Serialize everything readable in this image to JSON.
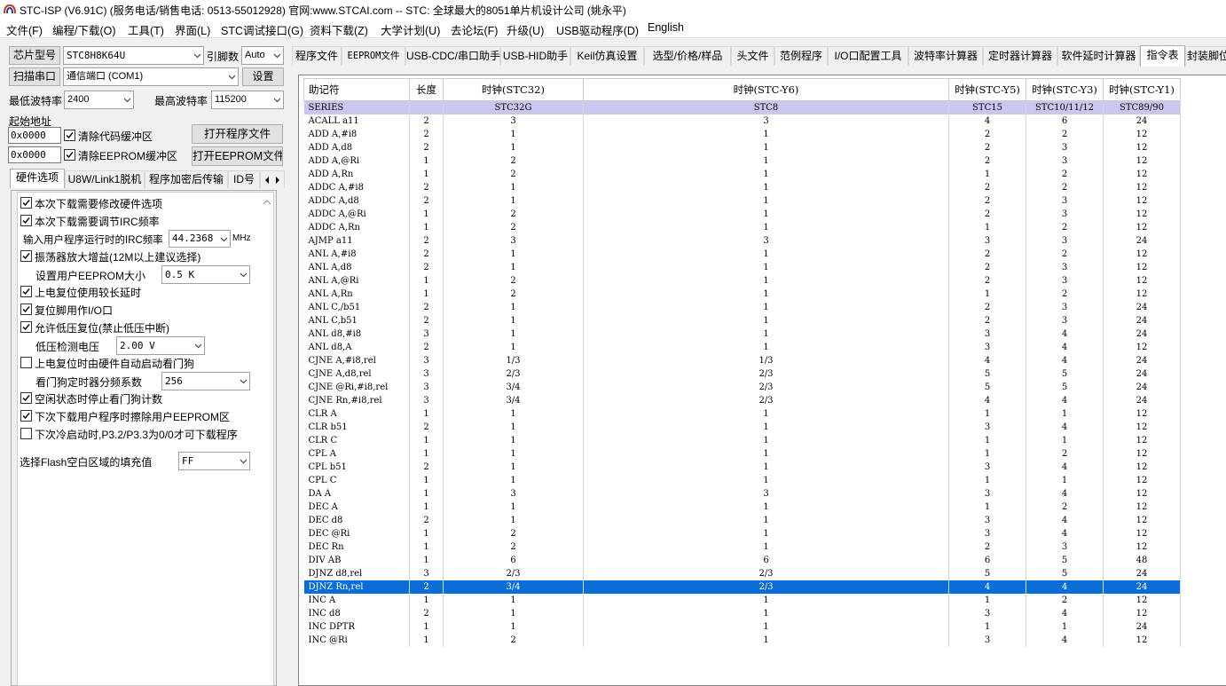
{
  "window": {
    "title": "STC-ISP (V6.91C) (服务电话/销售电话: 0513-55012928) 官网:www.STCAI.com  -- STC: 全球最大的8051单片机设计公司 (姚永平)"
  },
  "menu": [
    "文件(F)",
    "编程/下载(O)",
    "工具(T)",
    "界面(L)",
    "STC调试接口(G)",
    "资料下载(Z)",
    "大学计划(U)",
    "去论坛(F)",
    "升级(U)",
    "USB驱动程序(D)",
    "English"
  ],
  "left": {
    "chip_btn": "芯片型号",
    "chip_value": "STC8H8K64U",
    "pin_label": "引脚数",
    "pin_value": "Auto",
    "scan_btn": "扫描串口",
    "port_value": "通信端口 (COM1)",
    "settings_btn": "设置",
    "min_baud_label": "最低波特率",
    "min_baud_value": "2400",
    "max_baud_label": "最高波特率",
    "max_baud_value": "115200",
    "start_addr_label": "起始地址",
    "addr1": "0x0000",
    "clear_code": "清除代码缓冲区",
    "open_prog_btn": "打开程序文件",
    "addr2": "0x0000",
    "clear_eeprom": "清除EEPROM缓冲区",
    "open_eeprom_btn": "打开EEPROM文件",
    "tabs": [
      "硬件选项",
      "U8W/Link1脱机",
      "程序加密后传输",
      "ID号"
    ],
    "options": {
      "o1": "本次下载需要修改硬件选项",
      "o2": "本次下载需要调节IRC频率",
      "irc_label": "输入用户程序运行时的IRC频率",
      "irc_value": "44.2368",
      "irc_unit": "MHz",
      "o3": "振荡器放大增益(12M以上建议选择)",
      "eeprom_size_label": "设置用户EEPROM大小",
      "eeprom_size_value": "0.5 K",
      "o4": "上电复位使用较长延时",
      "o5": "复位脚用作I/O口",
      "o6": "允许低压复位(禁止低压中断)",
      "lv_label": "低压检测电压",
      "lv_value": "2.00 V",
      "o7": "上电复位时由硬件自动启动看门狗",
      "wdt_label": "看门狗定时器分频系数",
      "wdt_value": "256",
      "o8": "空闲状态时停止看门狗计数",
      "o9": "下次下载用户程序时擦除用户EEPROM区",
      "o10": "下次冷启动时,P3.2/P3.3为0/0才可下载程序",
      "fill_label": "选择Flash空白区域的填充值",
      "fill_value": "FF"
    }
  },
  "right_tabs": [
    "程序文件",
    "EEPROM文件",
    "USB-CDC/串口助手",
    "USB-HID助手",
    "Keil仿真设置",
    "选型/价格/样品",
    "头文件",
    "范例程序",
    "I/O口配置工具",
    "波特率计算器",
    "定时器计算器",
    "软件延时计算器",
    "指令表",
    "封装脚位"
  ],
  "table": {
    "headers": [
      "助记符",
      "长度",
      "时钟(STC32)",
      "时钟(STC-Y6)",
      "时钟(STC-Y5)",
      "时钟(STC-Y3)",
      "时钟(STC-Y1)"
    ],
    "series": [
      "SERIES",
      "",
      "STC32G",
      "STC8",
      "STC15",
      "STC10/11/12",
      "STC89/90"
    ],
    "rows": [
      [
        "ACALL a11",
        "2",
        "3",
        "3",
        "4",
        "6",
        "24"
      ],
      [
        "ADD A,#i8",
        "2",
        "1",
        "1",
        "2",
        "2",
        "12"
      ],
      [
        "ADD A,d8",
        "2",
        "1",
        "1",
        "2",
        "3",
        "12"
      ],
      [
        "ADD A,@Ri",
        "1",
        "2",
        "1",
        "2",
        "3",
        "12"
      ],
      [
        "ADD A,Rn",
        "1",
        "2",
        "1",
        "1",
        "2",
        "12"
      ],
      [
        "ADDC A,#i8",
        "2",
        "1",
        "1",
        "2",
        "2",
        "12"
      ],
      [
        "ADDC A,d8",
        "2",
        "1",
        "1",
        "2",
        "3",
        "12"
      ],
      [
        "ADDC A,@Ri",
        "1",
        "2",
        "1",
        "2",
        "3",
        "12"
      ],
      [
        "ADDC A,Rn",
        "1",
        "2",
        "1",
        "1",
        "2",
        "12"
      ],
      [
        "AJMP a11",
        "2",
        "3",
        "3",
        "3",
        "3",
        "24"
      ],
      [
        "ANL A,#i8",
        "2",
        "1",
        "1",
        "2",
        "2",
        "12"
      ],
      [
        "ANL A,d8",
        "2",
        "1",
        "1",
        "2",
        "3",
        "12"
      ],
      [
        "ANL A,@Ri",
        "1",
        "2",
        "1",
        "2",
        "3",
        "12"
      ],
      [
        "ANL A,Rn",
        "1",
        "2",
        "1",
        "1",
        "2",
        "12"
      ],
      [
        "ANL C,/b51",
        "2",
        "1",
        "1",
        "2",
        "3",
        "24"
      ],
      [
        "ANL C,b51",
        "2",
        "1",
        "1",
        "2",
        "3",
        "24"
      ],
      [
        "ANL d8,#i8",
        "3",
        "1",
        "1",
        "3",
        "4",
        "24"
      ],
      [
        "ANL d8,A",
        "2",
        "1",
        "1",
        "3",
        "4",
        "12"
      ],
      [
        "CJNE A,#i8,rel",
        "3",
        "1/3",
        "1/3",
        "4",
        "4",
        "24"
      ],
      [
        "CJNE A,d8,rel",
        "3",
        "2/3",
        "2/3",
        "5",
        "5",
        "24"
      ],
      [
        "CJNE @Ri,#i8,rel",
        "3",
        "3/4",
        "2/3",
        "5",
        "5",
        "24"
      ],
      [
        "CJNE Rn,#i8,rel",
        "3",
        "3/4",
        "2/3",
        "4",
        "4",
        "24"
      ],
      [
        "CLR A",
        "1",
        "1",
        "1",
        "1",
        "1",
        "12"
      ],
      [
        "CLR b51",
        "2",
        "1",
        "1",
        "3",
        "4",
        "12"
      ],
      [
        "CLR C",
        "1",
        "1",
        "1",
        "1",
        "1",
        "12"
      ],
      [
        "CPL A",
        "1",
        "1",
        "1",
        "1",
        "2",
        "12"
      ],
      [
        "CPL b51",
        "2",
        "1",
        "1",
        "3",
        "4",
        "12"
      ],
      [
        "CPL C",
        "1",
        "1",
        "1",
        "1",
        "1",
        "12"
      ],
      [
        "DA A",
        "1",
        "3",
        "3",
        "3",
        "4",
        "12"
      ],
      [
        "DEC A",
        "1",
        "1",
        "1",
        "1",
        "2",
        "12"
      ],
      [
        "DEC d8",
        "2",
        "1",
        "1",
        "3",
        "4",
        "12"
      ],
      [
        "DEC @Ri",
        "1",
        "2",
        "1",
        "3",
        "4",
        "12"
      ],
      [
        "DEC Rn",
        "1",
        "2",
        "1",
        "2",
        "3",
        "12"
      ],
      [
        "DIV AB",
        "1",
        "6",
        "6",
        "6",
        "5",
        "48"
      ],
      [
        "DJNZ d8,rel",
        "3",
        "2/3",
        "2/3",
        "5",
        "5",
        "24"
      ],
      [
        "DJNZ Rn,rel",
        "2",
        "3/4",
        "2/3",
        "4",
        "4",
        "24"
      ],
      [
        "INC A",
        "1",
        "1",
        "1",
        "1",
        "2",
        "12"
      ],
      [
        "INC d8",
        "2",
        "1",
        "1",
        "3",
        "4",
        "12"
      ],
      [
        "INC DPTR",
        "1",
        "1",
        "1",
        "1",
        "1",
        "24"
      ],
      [
        "INC @Ri",
        "1",
        "2",
        "1",
        "3",
        "4",
        "12"
      ]
    ],
    "selected_index": 35
  }
}
